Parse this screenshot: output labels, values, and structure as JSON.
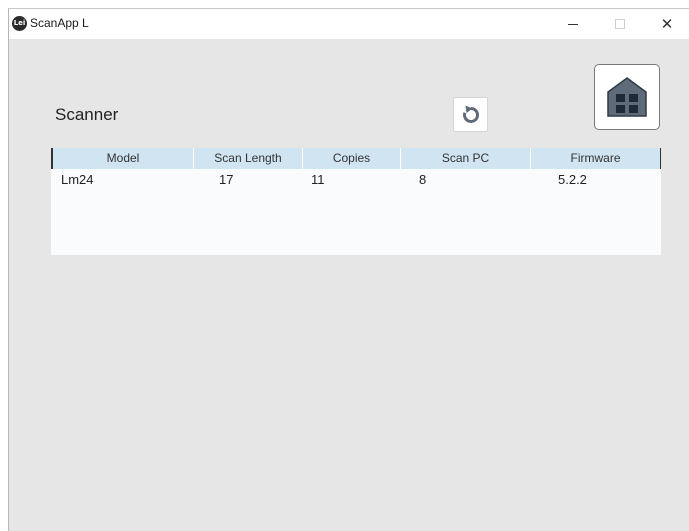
{
  "window": {
    "title": "ScanApp L",
    "logo_text": "Lei",
    "controls": {
      "minimize_icon": "minimize-icon",
      "maximize_icon": "maximize-icon",
      "close_icon": "close-icon",
      "close_glyph": "✕"
    }
  },
  "page": {
    "title": "Scanner"
  },
  "toolbar": {
    "refresh_icon": "refresh-icon",
    "home_icon": "home-icon"
  },
  "table": {
    "columns": [
      "Model",
      "Scan Length",
      "Copies",
      "Scan PC",
      "Firmware"
    ],
    "rows": [
      [
        "Lm24",
        "17",
        "11",
        "8",
        "5.2.2"
      ]
    ]
  },
  "colors": {
    "background": "#e6e6e6",
    "header_bg": "#d1e4f1",
    "table_bg": "#f9fbfd",
    "icon_gray": "#5f6b78"
  }
}
